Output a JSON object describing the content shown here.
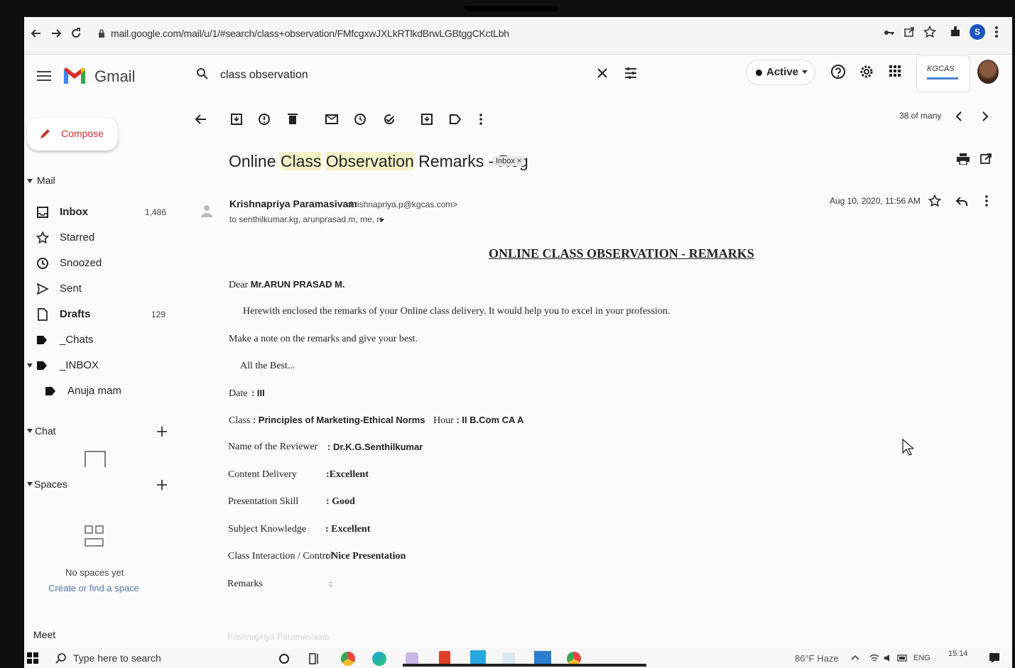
{
  "browser": {
    "url": "mail.google.com/mail/u/1/#search/class+observation/FMfcgxwJXLkRTlkdBrwLGBtggCKctLbh",
    "profile_initial": "S"
  },
  "header": {
    "app_name": "Gmail",
    "search_value": "class observation",
    "status": "Active",
    "org_logo_text": "KGCAS"
  },
  "toolbar": {
    "pagination": "38 of many"
  },
  "sidebar": {
    "compose": "Compose",
    "mail_section": "Mail",
    "items": [
      {
        "label": "Inbox",
        "count": "1,486",
        "bold": true
      },
      {
        "label": "Starred",
        "count": ""
      },
      {
        "label": "Snoozed",
        "count": ""
      },
      {
        "label": "Sent",
        "count": ""
      },
      {
        "label": "Drafts",
        "count": "129",
        "bold": true
      },
      {
        "label": "_Chats",
        "count": ""
      },
      {
        "label": "_INBOX",
        "count": ""
      },
      {
        "label": "Anuja mam",
        "count": ""
      }
    ],
    "chat_section": "Chat",
    "spaces_section": "Spaces",
    "no_spaces": "No spaces yet",
    "create_space": "Create or find a space",
    "meet_section": "Meet"
  },
  "message": {
    "subject_pre": "Online ",
    "subject_hl1": "Class",
    "subject_mid": " ",
    "subject_hl2": "Observation",
    "subject_post": " Remarks - Reg",
    "label_badge": "Inbox ×",
    "sender_name": "Krishnapriya Paramasivam",
    "sender_email": "<krishnapriya.p@kgcas.com>",
    "recipients": "to senthilkumar.kg, arunprasad.m, me, rr",
    "date": "Aug 10, 2020, 11:56 AM",
    "body": {
      "title": "ONLINE CLASS OBSERVATION - REMARKS",
      "greeting_label": "Dear",
      "greeting_name": "Mr.ARUN PRASAD M.",
      "line1": "Herewith enclosed the remarks of your Online class delivery. It would help you to excel in your profession.",
      "line2": "Make a note on the remarks and give your best.",
      "line3": "All the Best...",
      "date_label": "Date",
      "date_value": ": III",
      "class_label": "Class",
      "class_value": ": Principles of Marketing-Ethical Norms",
      "hour_label": "Hour",
      "hour_value": ": II B.Com CA A",
      "reviewer_label": "Name of the Reviewer",
      "reviewer_value": ": Dr.K.G.Senthilkumar",
      "content_label": "Content Delivery",
      "content_value": ":Excellent",
      "presentation_label": "Presentation Skill",
      "presentation_value": ": Good",
      "knowledge_label": "Subject Knowledge",
      "knowledge_value": ": Excellent",
      "interaction_label": "Class Interaction / Control",
      "interaction_value": ": Nice Presentation",
      "remarks_label": "Remarks",
      "remarks_value": ":",
      "signature": "Krishnapriya Paramasivam"
    }
  },
  "taskbar": {
    "search_placeholder": "Type here to search",
    "weather": "86°F Haze",
    "language": "ENG",
    "time": "15:14"
  },
  "colors": {
    "gmail_red": "#d93025",
    "gmail_blue": "#4285f4",
    "gmail_yellow": "#fbbc04",
    "gmail_green": "#34a853",
    "subject_highlight": "#f6f3c8"
  }
}
